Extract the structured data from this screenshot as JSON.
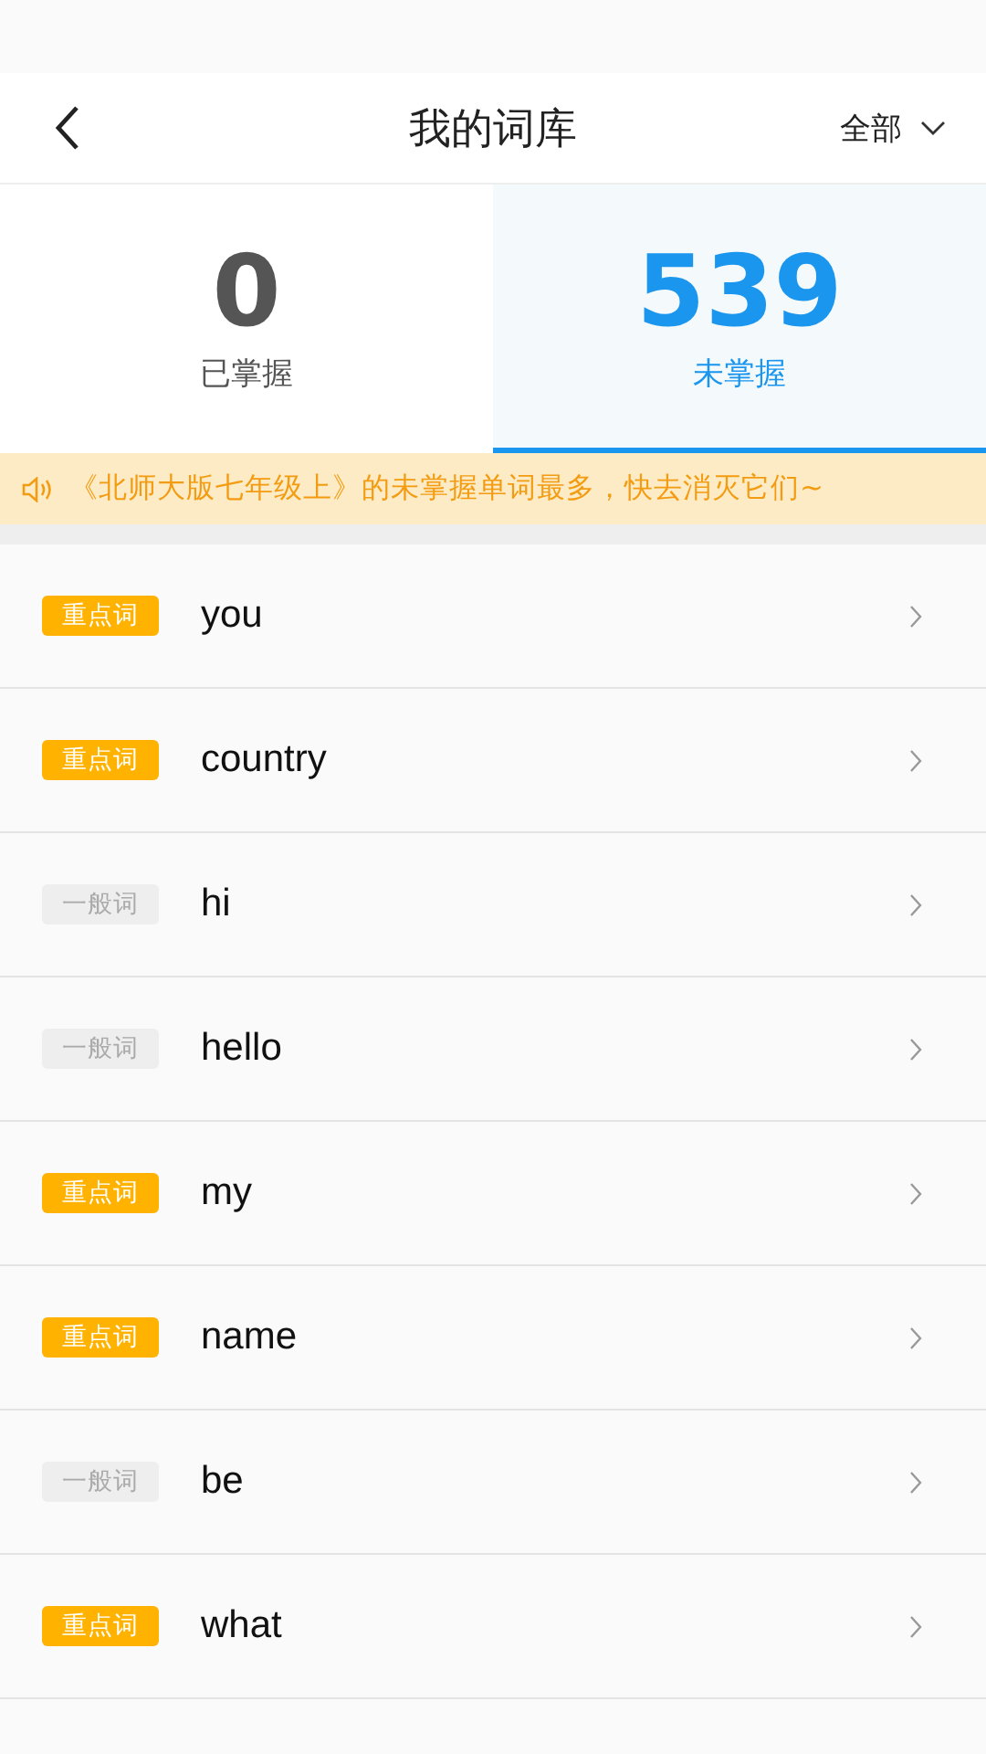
{
  "header": {
    "title": "我的词库",
    "filter": "全部"
  },
  "stats": [
    {
      "count": "0",
      "label": "已掌握",
      "selected": false
    },
    {
      "count": "539",
      "label": "未掌握",
      "selected": true
    }
  ],
  "notice": "《北师大版七年级上》的未掌握单词最多，快去消灭它们~",
  "words": [
    {
      "tag": "重点词",
      "kind": "key",
      "word": "you"
    },
    {
      "tag": "重点词",
      "kind": "key",
      "word": "country"
    },
    {
      "tag": "一般词",
      "kind": "general",
      "word": "hi"
    },
    {
      "tag": "一般词",
      "kind": "general",
      "word": "hello"
    },
    {
      "tag": "重点词",
      "kind": "key",
      "word": "my"
    },
    {
      "tag": "重点词",
      "kind": "key",
      "word": "name"
    },
    {
      "tag": "一般词",
      "kind": "general",
      "word": "be"
    },
    {
      "tag": "重点词",
      "kind": "key",
      "word": "what"
    }
  ]
}
